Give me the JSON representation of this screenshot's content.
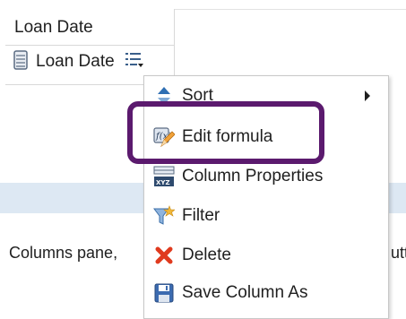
{
  "column_card": {
    "header_label": "Loan Date",
    "chip_label": "Loan Date",
    "icons": {
      "column": "column-icon",
      "menu": "menu-icon"
    }
  },
  "background": {
    "pane_text": "Columns pane,",
    "pane_text_right": "utt"
  },
  "context_menu": {
    "items": [
      {
        "label": "Sort",
        "icon": "sort-icon",
        "has_submenu": true
      },
      {
        "label": "Edit formula",
        "icon": "edit-formula-icon",
        "has_submenu": false
      },
      {
        "label": "Column Properties",
        "icon": "column-properties-icon",
        "has_submenu": false
      },
      {
        "label": "Filter",
        "icon": "filter-icon",
        "has_submenu": false
      },
      {
        "label": "Delete",
        "icon": "delete-icon",
        "has_submenu": false
      },
      {
        "label": "Save Column As",
        "icon": "save-icon",
        "has_submenu": false
      }
    ]
  },
  "annotation": {
    "highlighted_item": "Edit formula",
    "color": "#5b1a6e"
  },
  "colors": {
    "pane_band": "#dde8f3",
    "delete_red": "#e03a1e",
    "sort_blue": "#2f6fb3"
  }
}
